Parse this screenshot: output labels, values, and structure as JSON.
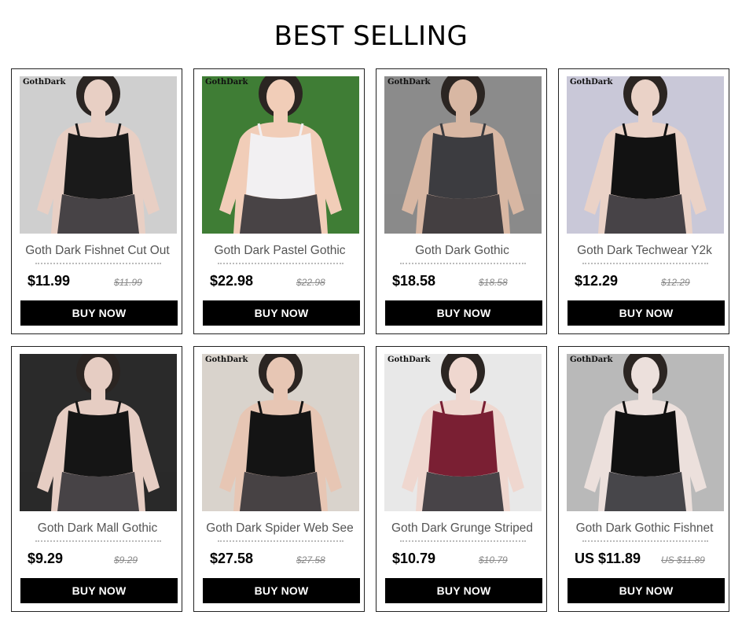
{
  "section": {
    "title": "BEST SELLING"
  },
  "products": [
    {
      "name": "Goth Dark Fishnet Cut Out",
      "price": "$11.99",
      "old_price": "$11.99",
      "button": "BUY NOW",
      "brand_mark": "GothDark",
      "image": "black top with fishnet sleeves and skirt",
      "colors": {
        "bg": "#cfcfcf",
        "main": "#1a1a1a",
        "skin": "#e8cfc4"
      }
    },
    {
      "name": "Goth Dark Pastel Gothic",
      "price": "$22.98",
      "old_price": "$22.98",
      "button": "BUY NOW",
      "brand_mark": "GothDark",
      "image": "white romper on lawn",
      "colors": {
        "bg": "#3f7d35",
        "main": "#f2f0f2",
        "skin": "#f1cdb8"
      }
    },
    {
      "name": "Goth Dark Gothic",
      "price": "$18.58",
      "old_price": "$18.58",
      "button": "BUY NOW",
      "brand_mark": "GothDark",
      "image": "grey corset top",
      "colors": {
        "bg": "#8b8b8b",
        "main": "#3c3c40",
        "skin": "#d8b7a3"
      }
    },
    {
      "name": "Goth Dark Techwear Y2k",
      "price": "$12.29",
      "old_price": "$12.29",
      "button": "BUY NOW",
      "brand_mark": "GothDark",
      "image": "black harness bodysuit",
      "colors": {
        "bg": "#c9c8d8",
        "main": "#121212",
        "skin": "#ead2c7"
      }
    },
    {
      "name": "Goth Dark Mall Gothic",
      "price": "$9.29",
      "old_price": "$9.29",
      "button": "BUY NOW",
      "brand_mark": "",
      "image": "black lace cami",
      "colors": {
        "bg": "#2a2a2a",
        "main": "#151515",
        "skin": "#e6cdc3"
      }
    },
    {
      "name": "Goth Dark Spider Web See",
      "price": "$27.58",
      "old_price": "$27.58",
      "button": "BUY NOW",
      "brand_mark": "GothDark",
      "image": "black top with spider web back",
      "colors": {
        "bg": "#d9d3cc",
        "main": "#141414",
        "skin": "#e7c6b4"
      }
    },
    {
      "name": "Goth Dark Grunge Striped",
      "price": "$10.79",
      "old_price": "$10.79",
      "button": "BUY NOW",
      "brand_mark": "GothDark",
      "image": "red black striped top and jeans",
      "colors": {
        "bg": "#e8e8e8",
        "main": "#7a1f33",
        "skin": "#efd7cf"
      }
    },
    {
      "name": "Goth Dark Gothic Fishnet",
      "price": "US $11.89",
      "old_price": "US $11.89",
      "button": "BUY NOW",
      "brand_mark": "GothDark",
      "image": "black fishnet bodysuit",
      "colors": {
        "bg": "#b9b9b9",
        "main": "#101010",
        "skin": "#ece0dc"
      }
    }
  ]
}
